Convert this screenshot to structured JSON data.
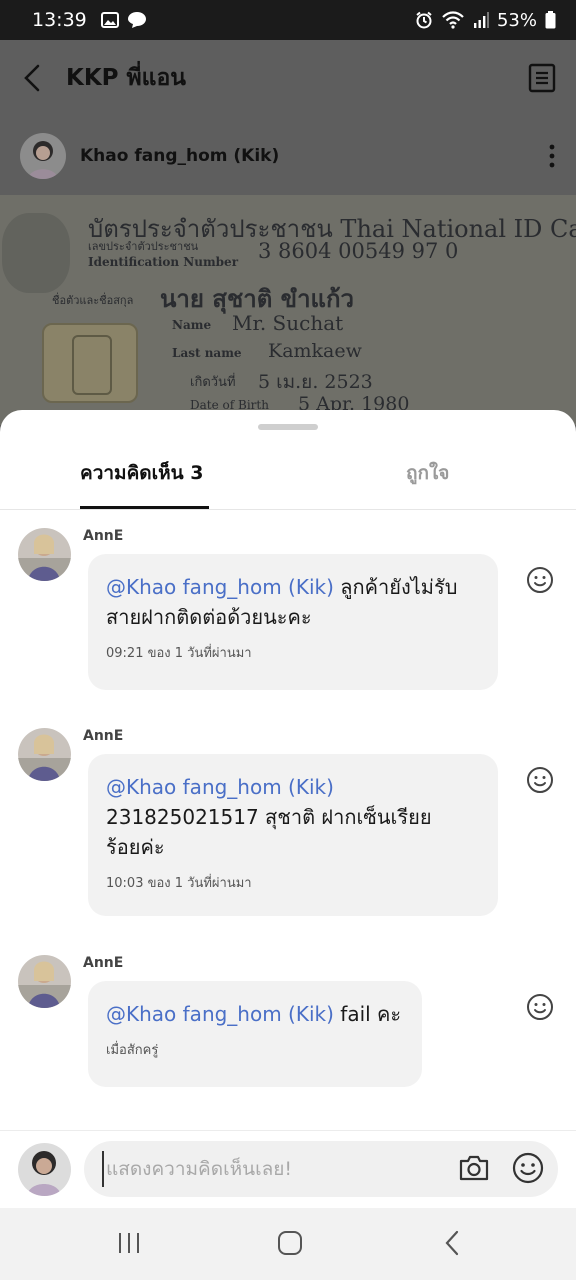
{
  "status_bar": {
    "time": "13:39",
    "battery": "53%"
  },
  "app_bar": {
    "title": "KKP พี่แอน"
  },
  "post": {
    "author": "Khao fang_hom (Kik)",
    "id_card_lines": [
      "บัตรประจำตัวประชาชน Thai National ID Card",
      "เลขประจำตัวประชาชน",
      "3 8604 00549 97 0",
      "Identification Number",
      "ชื่อตัวและชื่อสกุล",
      "นาย สุชาติ ขำแก้ว",
      "Name",
      "Mr. Suchat",
      "Last name",
      "Kamkaew",
      "เกิดวันที่",
      "5 เม.ย. 2523",
      "Date of Birth",
      "5 Apr. 1980"
    ]
  },
  "tabs": [
    {
      "label": "ความคิดเห็น 3",
      "active": true
    },
    {
      "label": "ถูกใจ",
      "active": false
    }
  ],
  "comments": [
    {
      "author": "AnnE",
      "mention": "@Khao fang_hom (Kik)",
      "line1_rest": " ลูกค้ายังไม่รับ",
      "line2": "สายฝากติดต่อด้วยนะคะ",
      "line3": "",
      "time": "09:21 ของ 1 วันที่ผ่านมา"
    },
    {
      "author": "AnnE",
      "mention": "@Khao fang_hom (Kik)",
      "line1_rest": "",
      "line2": "231825021517 สุชาติ ฝากเซ็นเรียย",
      "line3": "ร้อยค่ะ",
      "time": "10:03 ของ 1 วันที่ผ่านมา"
    },
    {
      "author": "AnnE",
      "mention": "@Khao fang_hom (Kik)",
      "line1_rest": " fail คะ",
      "line2": "",
      "line3": "",
      "time": "เมื่อสักครู่"
    }
  ],
  "input": {
    "placeholder": "แสดงความคิดเห็นเลย!",
    "value": ""
  },
  "icons": {
    "back": "back-arrow-icon",
    "note": "note-icon",
    "more": "more-vertical-icon",
    "react": "smiley-icon",
    "camera": "camera-icon",
    "emoji": "emoji-icon"
  },
  "colors": {
    "mention": "#4a6fc7",
    "bubble": "#f2f2f2",
    "dim": "#5f5f5f"
  }
}
